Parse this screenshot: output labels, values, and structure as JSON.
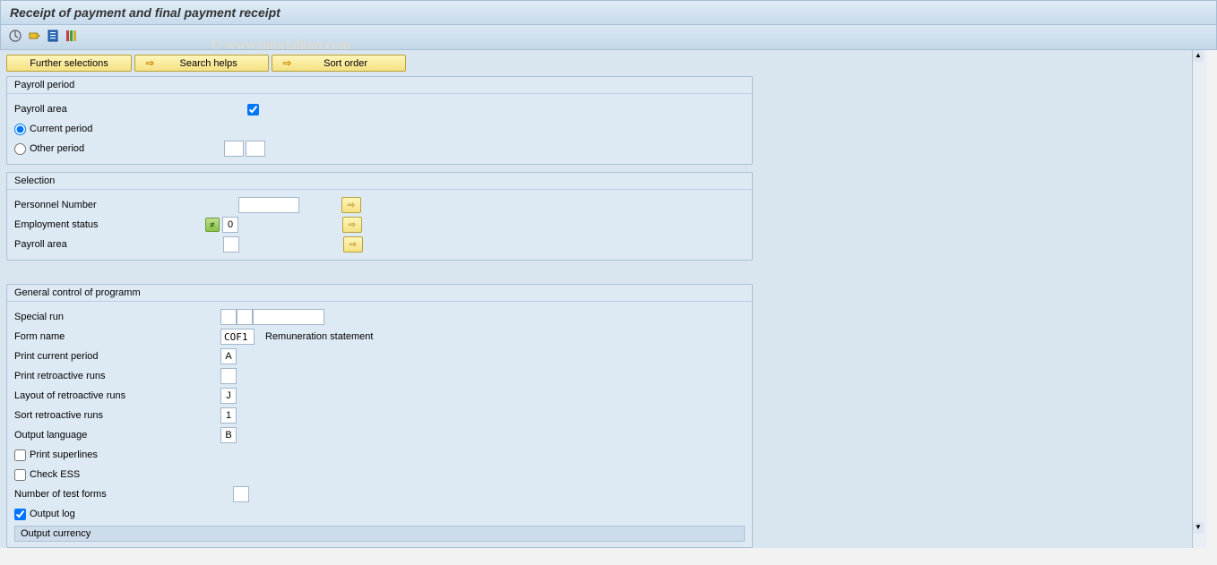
{
  "title": "Receipt of payment and final payment receipt",
  "watermark": "© www.tutorialkart.com",
  "buttons": {
    "further": "Further selections",
    "search": "Search helps",
    "sort": "Sort order"
  },
  "groups": {
    "payroll_period": {
      "title": "Payroll period",
      "payroll_area_label": "Payroll area",
      "current_period": "Current period",
      "other_period": "Other period"
    },
    "selection": {
      "title": "Selection",
      "personnel_number": "Personnel Number",
      "employment_status": "Employment status",
      "employment_status_val": "0",
      "payroll_area": "Payroll area"
    },
    "general": {
      "title": "General control of programm",
      "special_run": "Special run",
      "form_name": "Form name",
      "form_name_val": "COF1",
      "form_name_desc": "Remuneration statement",
      "print_current": "Print current period",
      "print_current_val": "A",
      "print_retro": "Print retroactive runs",
      "layout_retro": "Layout of retroactive runs",
      "layout_retro_val": "J",
      "sort_retro": "Sort retroactive runs",
      "sort_retro_val": "1",
      "output_lang": "Output language",
      "output_lang_val": "B",
      "print_superlines": "Print superlines",
      "check_ess": "Check ESS",
      "num_test": "Number of test forms",
      "output_log": "Output log",
      "output_currency": "Output currency"
    }
  }
}
